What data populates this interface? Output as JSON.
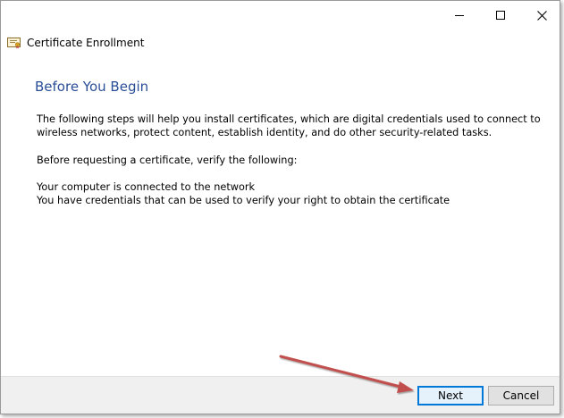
{
  "window": {
    "title": "Certificate Enrollment",
    "icons": {
      "minimize": "minimize-icon",
      "maximize": "maximize-icon",
      "close": "close-icon",
      "app": "certificate-icon"
    }
  },
  "page": {
    "title": "Before You Begin",
    "intro": "The following steps will help you install certificates, which are digital credentials used to connect to wireless networks, protect content, establish identity, and do other security-related tasks.",
    "verify_prompt": "Before requesting a certificate, verify the following:",
    "checklist": [
      "Your computer is connected to the network",
      "You have credentials that can be used to verify your right to obtain the certificate"
    ]
  },
  "footer": {
    "next_label": "Next",
    "cancel_label": "Cancel"
  },
  "colors": {
    "title_blue": "#2a4e96",
    "annotation_arrow": "#c0504d",
    "focus_border": "#0078d7"
  }
}
